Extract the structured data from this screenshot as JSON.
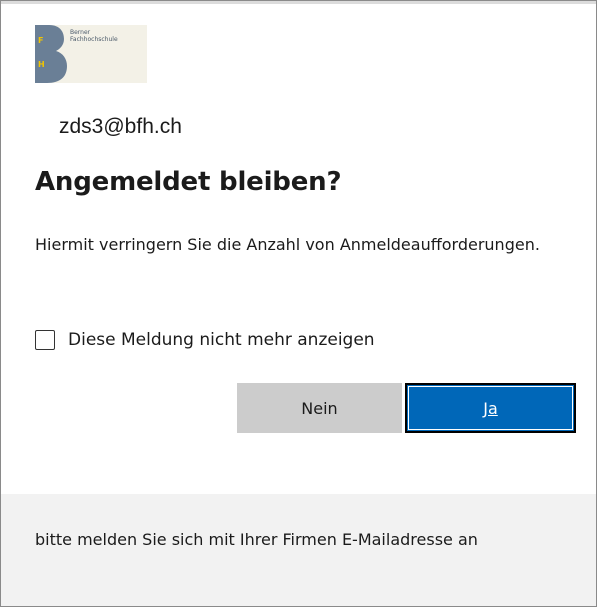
{
  "logo": {
    "text_line1": "Berner",
    "text_line2": "Fachhochschule",
    "mark_letters": [
      "F",
      "H"
    ],
    "colors": {
      "mark": "#6a7f96",
      "mark_letters": "#f2c500",
      "background": "#f3f1e7"
    }
  },
  "account": "zds3@bfh.ch",
  "title": "Angemeldet bleiben?",
  "description": "Hiermit verringern Sie die Anzahl von Anmeldeaufforderungen.",
  "checkbox": {
    "label": "Diese Meldung nicht mehr anzeigen",
    "checked": false
  },
  "buttons": {
    "no_label": "Nein",
    "yes_label": "Ja"
  },
  "footer": {
    "text": "bitte melden Sie sich mit Ihrer Firmen E-Mailadresse an"
  },
  "colors": {
    "primary": "#0067b8",
    "secondary_button": "#cccccc",
    "footer_background": "#f2f2f2"
  }
}
